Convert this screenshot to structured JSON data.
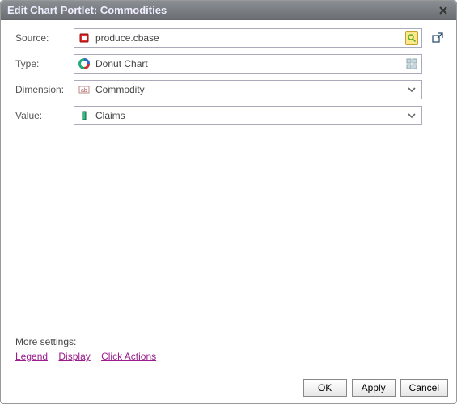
{
  "titlebar": {
    "title": "Edit Chart Portlet: Commodities"
  },
  "form": {
    "source": {
      "label": "Source:",
      "value": "produce.cbase"
    },
    "type": {
      "label": "Type:",
      "value": "Donut Chart"
    },
    "dimension": {
      "label": "Dimension:",
      "value": "Commodity"
    },
    "value": {
      "label": "Value:",
      "value": "Claims"
    }
  },
  "moreSettings": {
    "title": "More settings:",
    "links": {
      "legend": "Legend",
      "display": "Display",
      "clickActions": "Click Actions"
    }
  },
  "footer": {
    "ok": "OK",
    "apply": "Apply",
    "cancel": "Cancel"
  }
}
